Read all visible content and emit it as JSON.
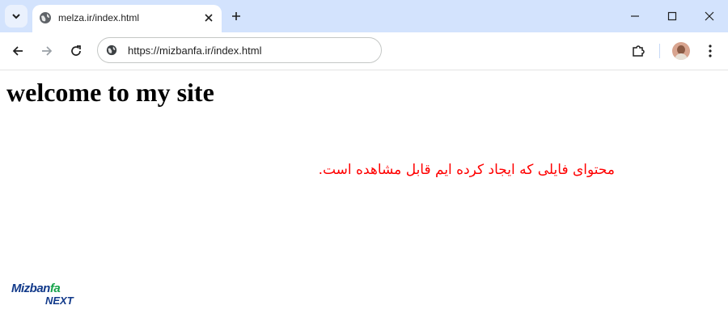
{
  "browser": {
    "tab": {
      "title": "melza.ir/index.html",
      "icon": "globe-icon"
    },
    "address_bar": {
      "url": "https://mizbanfa.ir/index.html"
    },
    "icons": {
      "tab_search": "chevron-down-icon",
      "close_tab": "close-icon",
      "new_tab": "plus-icon",
      "minimize": "minimize-icon",
      "maximize": "maximize-icon",
      "close_window": "close-icon",
      "back": "back-arrow-icon",
      "forward": "forward-arrow-icon",
      "reload": "reload-icon",
      "site_info": "globe-icon",
      "extensions": "puzzle-icon",
      "profile": "avatar",
      "menu": "kebab-menu-icon"
    }
  },
  "page": {
    "heading": "welcome to my site",
    "paragraph": "محتوای فایلی که ایجاد کرده ایم قابل مشاهده است."
  },
  "watermark": {
    "brand_main": "Mizban",
    "brand_accent": "fa",
    "brand_sub": "NEXT"
  },
  "colors": {
    "tabstrip": "#d3e3fd",
    "paragraph_text": "#ff0000",
    "watermark_blue": "#123a8a",
    "watermark_green": "#16a34a"
  }
}
